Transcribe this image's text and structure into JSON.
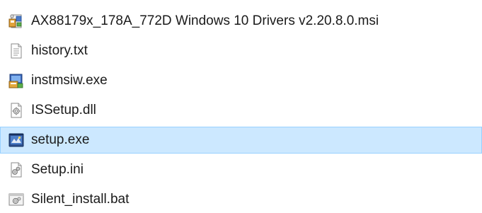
{
  "files": [
    {
      "name": "AX88179x_178A_772D Windows 10 Drivers v2.20.8.0.msi",
      "icon": "msi-installer-icon",
      "selected": false
    },
    {
      "name": "history.txt",
      "icon": "text-document-icon",
      "selected": false
    },
    {
      "name": "instmsiw.exe",
      "icon": "exe-installer-icon",
      "selected": false
    },
    {
      "name": "ISSetup.dll",
      "icon": "dll-file-icon",
      "selected": false
    },
    {
      "name": "setup.exe",
      "icon": "setup-exe-icon",
      "selected": true
    },
    {
      "name": "Setup.ini",
      "icon": "ini-settings-icon",
      "selected": false
    },
    {
      "name": "Silent_install.bat",
      "icon": "batch-file-icon",
      "selected": false
    }
  ],
  "colors": {
    "selection_fill": "#cce8ff",
    "selection_border": "#99d1ff",
    "text": "#1a1a1a"
  }
}
